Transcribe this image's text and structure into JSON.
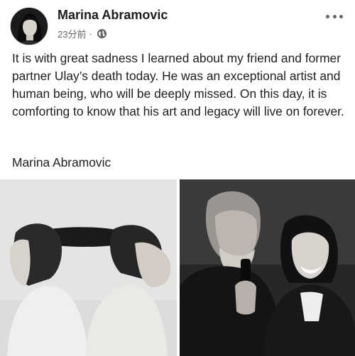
{
  "post": {
    "author": "Marina Abramovic",
    "time": "23分前",
    "separator": "·",
    "body": "It is with great sadness I learned about my friend and former partner Ulay’s death today. He was an exceptional artist and human being, who will be deeply missed. On this day, it is comforting to know that his art and legacy will live on forever.",
    "signature": "Marina Abramovic"
  },
  "icons": {
    "privacy": "globe-icon",
    "menu": "more-options-icon"
  },
  "colors": {
    "text": "#1c1e21",
    "meta": "#65676b"
  }
}
